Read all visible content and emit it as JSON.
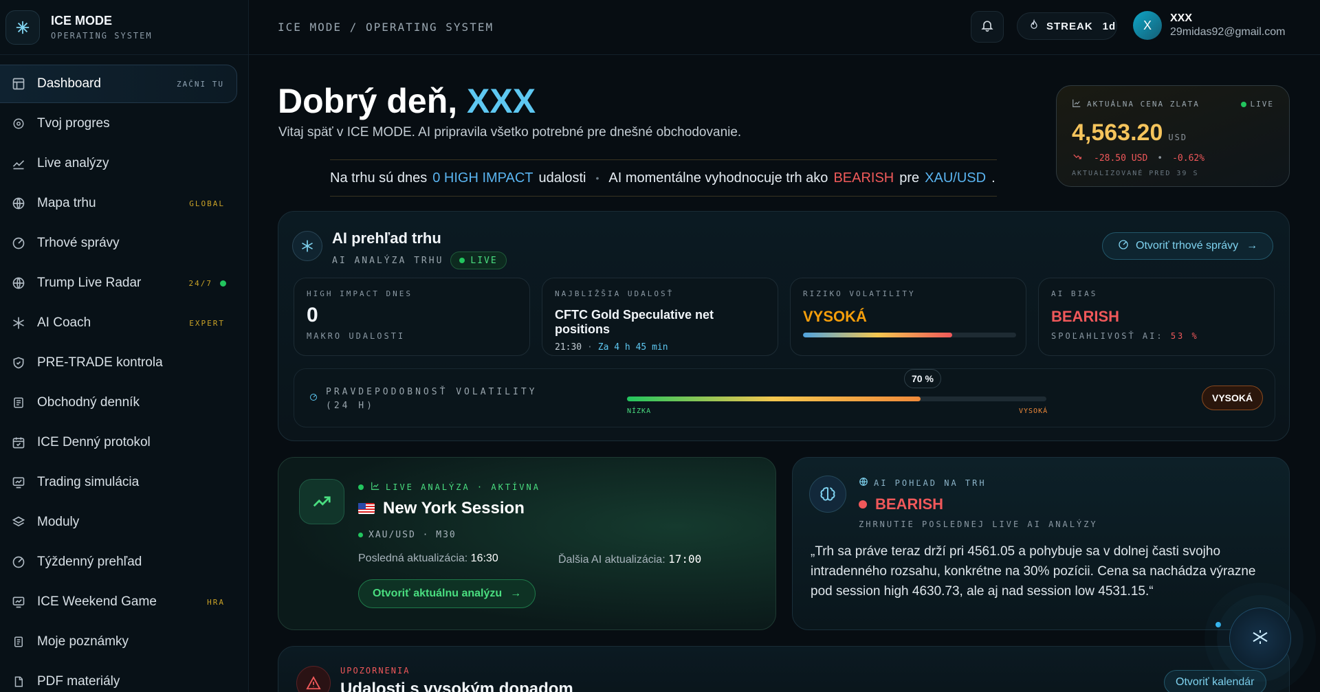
{
  "brand": {
    "title": "ICE MODE",
    "subtitle": "OPERATING SYSTEM"
  },
  "sidebar": {
    "items": [
      {
        "label": "Dashboard",
        "badge": "ZAČNI TU",
        "icon": "dashboard-icon",
        "active": true
      },
      {
        "label": "Tvoj progres",
        "icon": "target-icon"
      },
      {
        "label": "Live analýzy",
        "icon": "chart-line-icon"
      },
      {
        "label": "Mapa trhu",
        "badge": "GLOBAL",
        "icon": "globe-icon"
      },
      {
        "label": "Trhové správy",
        "icon": "radar-icon"
      },
      {
        "label": "Trump Live Radar",
        "badge": "24/7",
        "icon": "globe-icon",
        "live_dot": true
      },
      {
        "label": "AI Coach",
        "badge": "EXPERT",
        "icon": "snowflake-icon"
      },
      {
        "label": "PRE-TRADE kontrola",
        "icon": "shield-icon"
      },
      {
        "label": "Obchodný denník",
        "icon": "journal-icon"
      },
      {
        "label": "ICE Denný protokol",
        "icon": "calendar-icon"
      },
      {
        "label": "Trading simulácia",
        "icon": "monitor-chart-icon"
      },
      {
        "label": "Moduly",
        "icon": "layers-icon"
      },
      {
        "label": "Týždenný prehľad",
        "icon": "radar-icon"
      },
      {
        "label": "ICE Weekend Game",
        "badge": "HRA",
        "icon": "monitor-chart-icon"
      },
      {
        "label": "Moje poznámky",
        "icon": "notes-icon"
      },
      {
        "label": "PDF materiály",
        "icon": "file-icon"
      }
    ]
  },
  "topbar": {
    "breadcrumb": "ICE MODE / OPERATING SYSTEM",
    "streak_label": "STREAK",
    "streak_value": "1d",
    "avatar_initial": "X",
    "user_name": "XXX",
    "user_email": "29midas92@gmail.com"
  },
  "greeting": {
    "prefix": "Dobrý deň,",
    "name": "XXX",
    "subtitle": "Vitaj späť v ICE MODE. AI pripravila všetko potrebné pre dnešné obchodovanie."
  },
  "ticker": {
    "part1": "Na trhu sú dnes",
    "count": "0 HIGH IMPACT",
    "part2": "udalosti",
    "part3": "AI momentálne vyhodnocuje trh ako",
    "bias": "BEARISH",
    "part4": "pre",
    "pair": "XAU/USD",
    "end": "."
  },
  "gold": {
    "label": "AKTUÁLNA CENA ZLATA",
    "live": "LIVE",
    "price": "4,563.20",
    "currency": "USD",
    "change": "-28.50 USD",
    "change_pct": "-0.62%",
    "updated": "AKTUALIZOVANÉ PRED 39 S"
  },
  "ai_overview": {
    "title": "AI prehľad trhu",
    "subtitle": "AI ANALÝZA TRHU",
    "live": "LIVE",
    "news_button": "Otvoriť trhové správy",
    "high_impact_label": "HIGH IMPACT DNES",
    "high_impact_value": "0",
    "high_impact_foot": "MAKRO UDALOSTI",
    "next_event_label": "NAJBLIŽŠIA UDALOSŤ",
    "next_event_name": "CFTC Gold Speculative net positions",
    "next_event_time": "21:30",
    "next_event_in": "Za 4 h 45 min",
    "volatility_risk_label": "RIZIKO VOLATILITY",
    "volatility_risk_value": "VYSOKÁ",
    "volatility_risk_level": 0.7,
    "bias_label": "AI BIAS",
    "bias_value": "BEARISH",
    "reliability_label": "SPOĽAHLIVOSŤ AI:",
    "reliability_value": "53 %",
    "prob_label_1": "PRAVDEPODOBNOSŤ VOLATILITY",
    "prob_label_2": "(24 H)",
    "prob_pct": "70 %",
    "prob_level": 0.7,
    "prob_low": "NÍZKA",
    "prob_high": "VYSOKÁ",
    "prob_badge": "VYSOKÁ"
  },
  "ny_session": {
    "tag": "LIVE ANALÝZA · AKTÍVNA",
    "title": "New York Session",
    "pair": "XAU/USD · M30",
    "last_update_label": "Posledná aktualizácia:",
    "last_update_value": "16:30",
    "next_update_label": "Ďalšia AI aktualizácia:",
    "next_update_value": "17:00",
    "button": "Otvoriť aktuálnu analýzu"
  },
  "ai_view": {
    "tag": "AI POHĽAD NA TRH",
    "bias": "BEARISH",
    "subtitle": "ZHRNUTIE POSLEDNEJ LIVE AI ANALÝZY",
    "quote": "„Trh sa práve teraz drží pri 4561.05 a pohybuje sa v dolnej časti svojho intradenného rozsahu, konkrétne na 30% pozícii. Cena sa nachádza výrazne pod session high 4630.73, ale aj nad session low 4531.15.“"
  },
  "alerts": {
    "tag": "UPOZORNENIA",
    "title": "Udalosti s vysokým dopadom",
    "button": "Otvoriť kalendár"
  }
}
